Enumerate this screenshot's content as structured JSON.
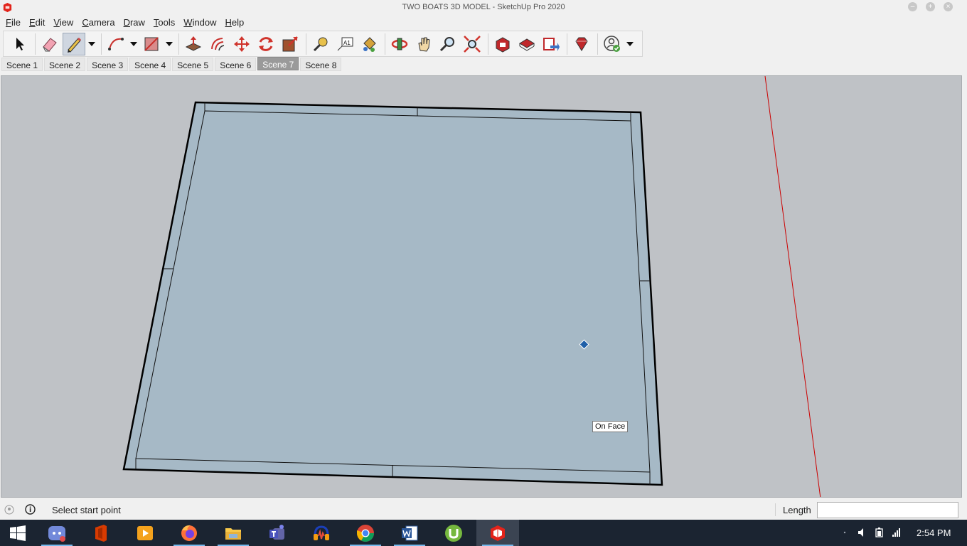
{
  "window": {
    "title": "TWO BOATS 3D MODEL - SketchUp Pro 2020",
    "controls": [
      "minimize",
      "maximize",
      "close"
    ]
  },
  "menu": [
    {
      "label": "File",
      "u": "F",
      "rest": "ile"
    },
    {
      "label": "Edit",
      "u": "E",
      "rest": "dit"
    },
    {
      "label": "View",
      "u": "V",
      "rest": "iew"
    },
    {
      "label": "Camera",
      "u": "C",
      "rest": "amera"
    },
    {
      "label": "Draw",
      "u": "D",
      "rest": "raw"
    },
    {
      "label": "Tools",
      "u": "T",
      "rest": "ools"
    },
    {
      "label": "Window",
      "u": "W",
      "rest": "indow"
    },
    {
      "label": "Help",
      "u": "H",
      "rest": "elp"
    }
  ],
  "toolbar": {
    "tools": [
      "select-arrow-icon",
      "eraser-icon",
      "pencil-line-icon",
      "arc-icon",
      "rectangle-icon",
      "push-pull-icon",
      "offset-icon",
      "move-icon",
      "rotate-icon",
      "scale-icon",
      "tape-measure-icon",
      "text-label-icon",
      "paint-bucket-icon",
      "orbit-icon",
      "pan-hand-icon",
      "zoom-icon",
      "zoom-extents-icon",
      "3d-warehouse-icon",
      "extension-warehouse-icon",
      "layout-send-icon",
      "ruby-extension-icon",
      "account-icon"
    ],
    "active_tool": "pencil-line-icon",
    "text_tool_glyph": "A1"
  },
  "scenes": {
    "tabs": [
      "Scene 1",
      "Scene 2",
      "Scene 3",
      "Scene 4",
      "Scene 5",
      "Scene 6",
      "Scene 7",
      "Scene 8"
    ],
    "selected": "Scene 7"
  },
  "viewport": {
    "background_color": "#bfc2c6",
    "face_color": "#a6b9c6",
    "edge_color": "#000000",
    "axis_color": "#cc0000",
    "inference_tooltip": "On Face"
  },
  "statusbar": {
    "message": "Select start point",
    "vcb_label": "Length",
    "vcb_value": ""
  },
  "taskbar": {
    "apps": [
      "windows-start-icon",
      "discord-icon",
      "office-icon",
      "media-player-icon",
      "firefox-icon",
      "file-explorer-icon",
      "teams-icon",
      "audacity-icon",
      "chrome-icon",
      "word-icon",
      "utorrent-icon",
      "sketchup-icon"
    ],
    "active_app": "sketchup-icon",
    "clock": "2:54 PM"
  }
}
